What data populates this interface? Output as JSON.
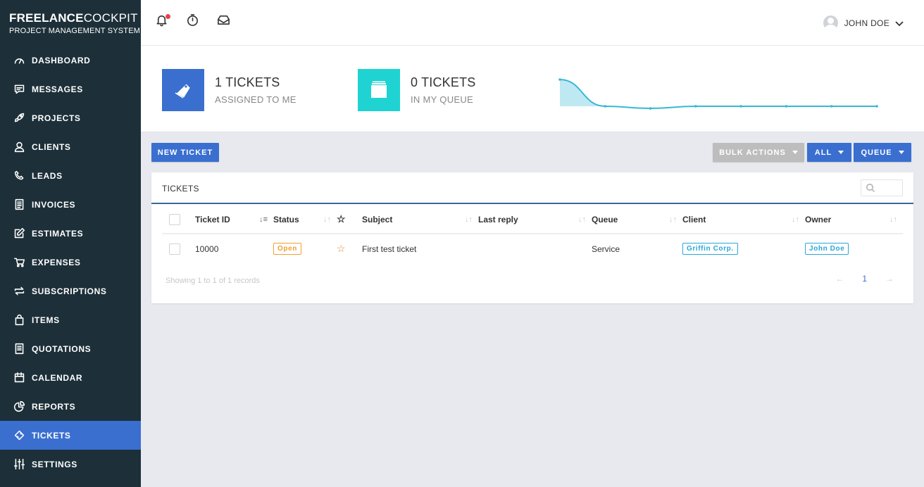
{
  "brand": {
    "name_bold": "FREELANCE",
    "name_light": "COCKPIT",
    "subtitle": "PROJECT MANAGEMENT SYSTEM"
  },
  "sidebar": {
    "items": [
      {
        "label": "DASHBOARD",
        "icon": "gauge-icon"
      },
      {
        "label": "MESSAGES",
        "icon": "message-icon"
      },
      {
        "label": "PROJECTS",
        "icon": "rocket-icon"
      },
      {
        "label": "CLIENTS",
        "icon": "user-icon"
      },
      {
        "label": "LEADS",
        "icon": "phone-icon"
      },
      {
        "label": "INVOICES",
        "icon": "invoice-icon"
      },
      {
        "label": "ESTIMATES",
        "icon": "edit-icon"
      },
      {
        "label": "EXPENSES",
        "icon": "cart-icon"
      },
      {
        "label": "SUBSCRIPTIONS",
        "icon": "repeat-icon"
      },
      {
        "label": "ITEMS",
        "icon": "bag-icon"
      },
      {
        "label": "QUOTATIONS",
        "icon": "document-icon"
      },
      {
        "label": "CALENDAR",
        "icon": "calendar-icon"
      },
      {
        "label": "REPORTS",
        "icon": "pie-chart-icon"
      },
      {
        "label": "TICKETS",
        "icon": "ticket-icon",
        "active": true
      },
      {
        "label": "SETTINGS",
        "icon": "sliders-icon"
      }
    ]
  },
  "topbar": {
    "user_name": "JOHN DOE"
  },
  "stats": {
    "assigned": {
      "count": "1 TICKETS",
      "caption": "ASSIGNED TO ME",
      "color": "#3a6fd0"
    },
    "queue": {
      "count": "0 TICKETS",
      "caption": "IN MY QUEUE",
      "color": "#1fd3d3"
    }
  },
  "sparkline": {
    "values": [
      1,
      0,
      -0.08,
      0,
      0,
      0,
      0,
      0
    ],
    "color": "#36b9d6"
  },
  "actions": {
    "new_ticket": "NEW TICKET",
    "bulk_actions": "BULK ACTIONS",
    "all": "ALL",
    "queue": "QUEUE"
  },
  "tickets": {
    "title": "TICKETS",
    "columns": {
      "id": "Ticket ID",
      "status": "Status",
      "subject": "Subject",
      "last_reply": "Last reply",
      "queue": "Queue",
      "client": "Client",
      "owner": "Owner"
    },
    "rows": [
      {
        "id": "10000",
        "status": "Open",
        "subject": "First test ticket",
        "last_reply": "",
        "queue": "Service",
        "client": "Griffin Corp.",
        "owner": "John Doe"
      }
    ],
    "info": "Showing 1 to 1 of 1 records",
    "page": "1"
  }
}
